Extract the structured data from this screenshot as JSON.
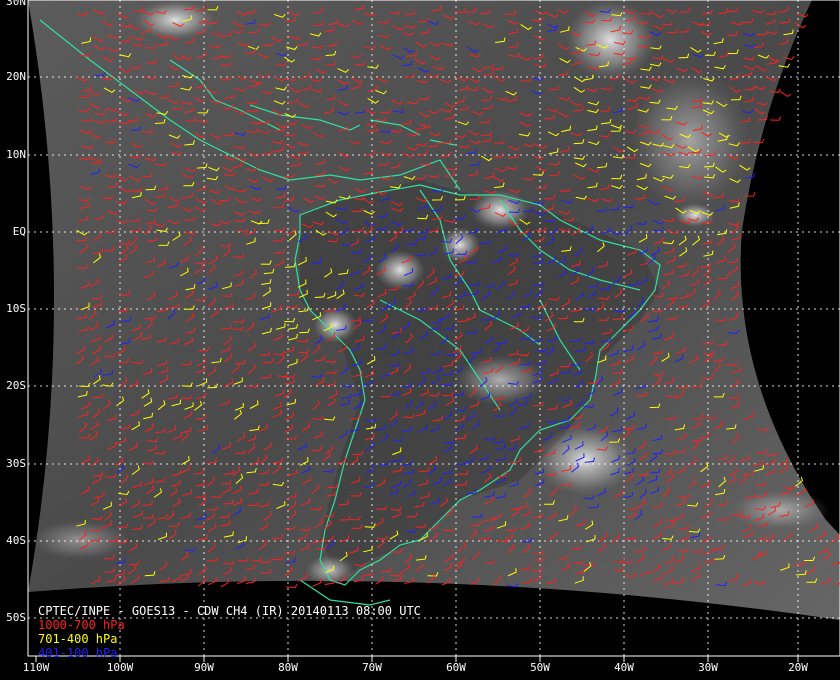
{
  "map": {
    "title": "CPTEC/INPE - GOES13 - CDW CH4 (IR) 20140113 08:00 UTC",
    "lat_labels": [
      "30N",
      "20N",
      "10N",
      "EQ",
      "10S",
      "20S",
      "30S",
      "40S",
      "50S"
    ],
    "lon_labels": [
      "110W",
      "100W",
      "90W",
      "80W",
      "70W",
      "60W",
      "50W",
      "40W",
      "30W",
      "20W"
    ],
    "legend": [
      {
        "text": "1000-700 hPa",
        "color": "#ff2020"
      },
      {
        "text": "701-400 hPa",
        "color": "#ffff00"
      },
      {
        "text": "401-100 hPa",
        "color": "#2020ff"
      }
    ],
    "colors": {
      "coast": "#30e0a0",
      "grid": "#ffffff",
      "background": "#000000"
    }
  }
}
